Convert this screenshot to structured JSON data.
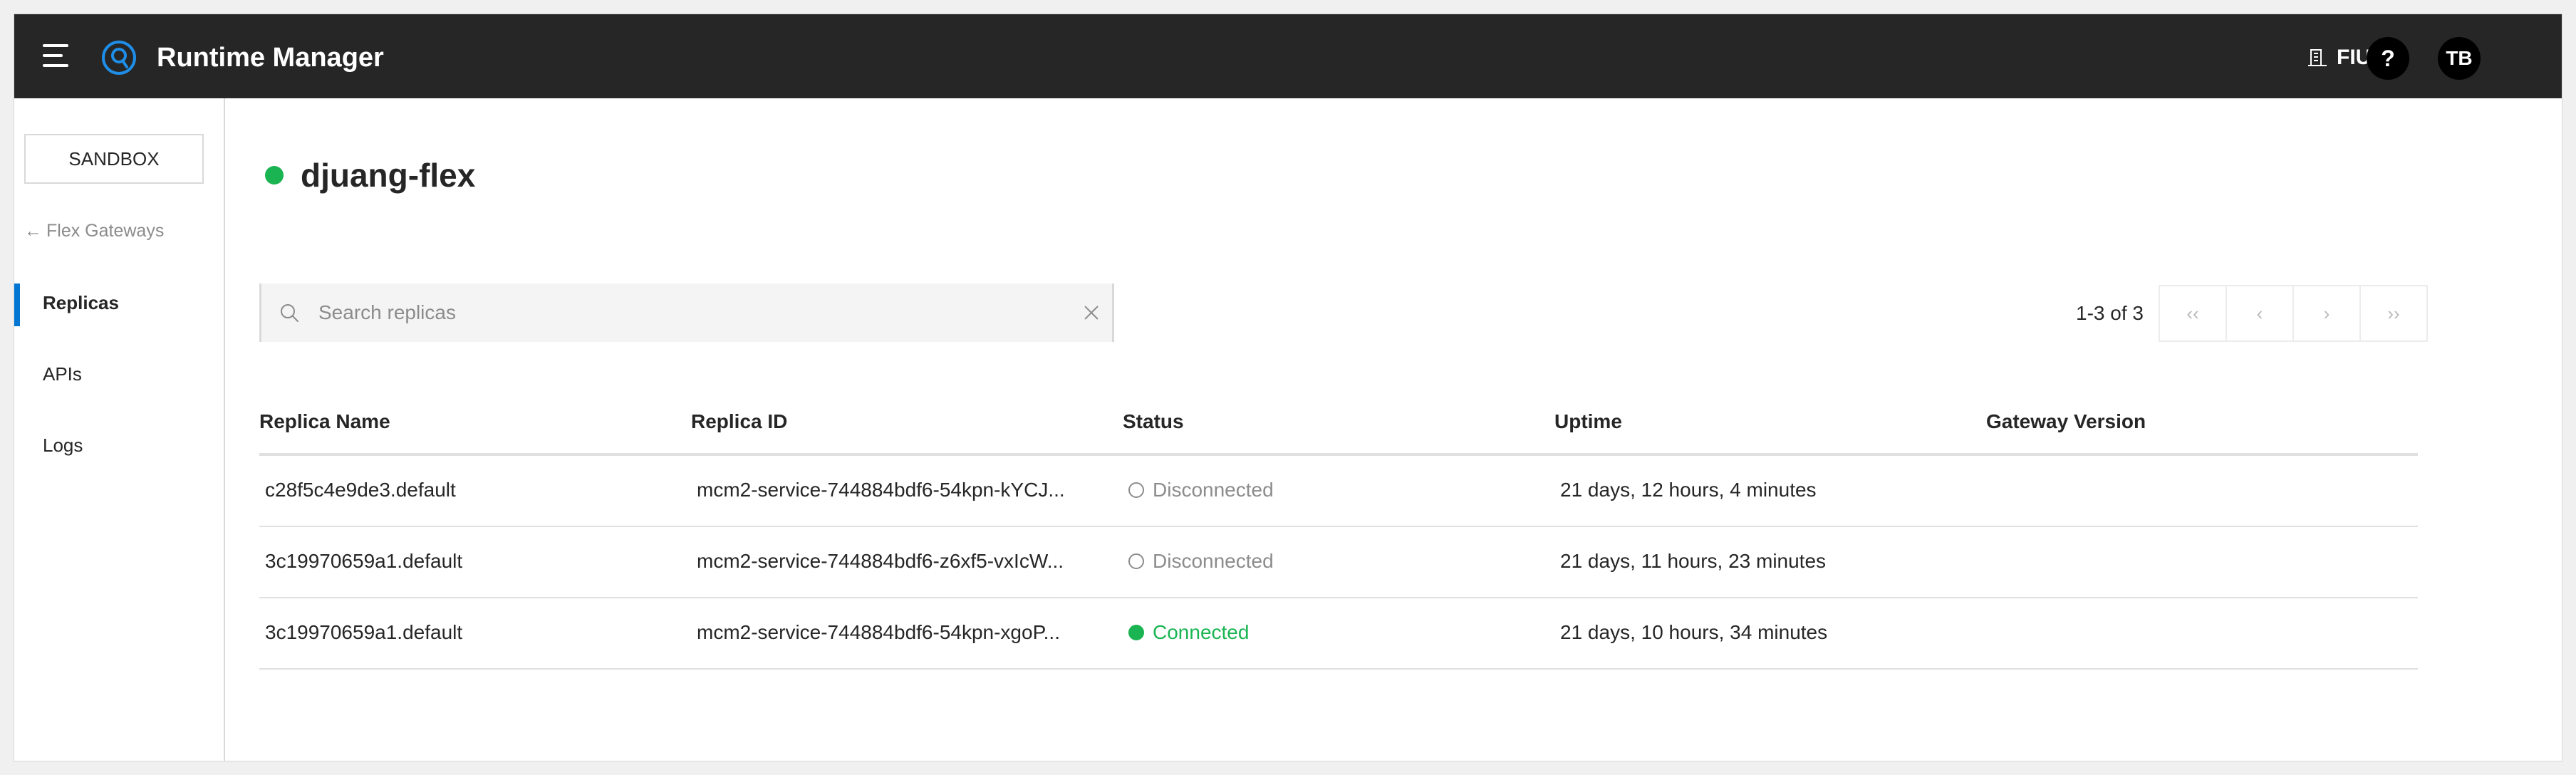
{
  "topbar": {
    "app_title": "Runtime Manager",
    "org_name": "FIUBA",
    "help_label": "?",
    "avatar_initials": "TB"
  },
  "sidebar": {
    "environment": "SANDBOX",
    "back_link": "Flex Gateways",
    "items": [
      {
        "label": "Replicas",
        "active": true
      },
      {
        "label": "APIs",
        "active": false
      },
      {
        "label": "Logs",
        "active": false
      }
    ]
  },
  "main": {
    "title": "djuang-flex",
    "title_status_color": "#1ab552",
    "search": {
      "placeholder": "Search replicas",
      "value": ""
    },
    "pagination": {
      "summary": "1-3 of 3",
      "first": "‹‹",
      "prev": "‹",
      "next": "›",
      "last": "››"
    },
    "table": {
      "headers": [
        "Replica Name",
        "Replica ID",
        "Status",
        "Uptime",
        "Gateway Version"
      ],
      "rows": [
        {
          "name": "c28f5c4e9de3.default",
          "id": "mcm2-service-744884bdf6-54kpn-kYCJ...",
          "status": "Disconnected",
          "uptime": "21 days, 12 hours, 4 minutes",
          "version": ""
        },
        {
          "name": "3c19970659a1.default",
          "id": "mcm2-service-744884bdf6-z6xf5-vxIcW...",
          "status": "Disconnected",
          "uptime": "21 days, 11 hours, 23 minutes",
          "version": ""
        },
        {
          "name": "3c19970659a1.default",
          "id": "mcm2-service-744884bdf6-54kpn-xgoP...",
          "status": "Connected",
          "uptime": "21 days, 10 hours, 34 minutes",
          "version": ""
        }
      ]
    }
  },
  "colors": {
    "topbar_bg": "#262626",
    "accent": "#0176d3",
    "connected": "#1ab552",
    "disconnected": "#8c8c8c"
  }
}
